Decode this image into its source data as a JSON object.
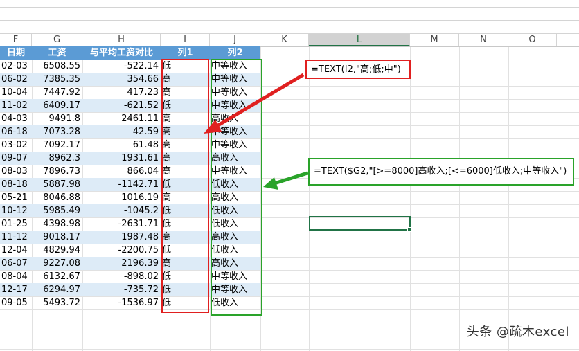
{
  "columns": [
    {
      "letter": "F",
      "selected": false
    },
    {
      "letter": "G",
      "selected": false
    },
    {
      "letter": "H",
      "selected": false
    },
    {
      "letter": "I",
      "selected": false
    },
    {
      "letter": "J",
      "selected": false
    },
    {
      "letter": "K",
      "selected": false
    },
    {
      "letter": "L",
      "selected": true
    },
    {
      "letter": "M",
      "selected": false
    },
    {
      "letter": "N",
      "selected": false
    },
    {
      "letter": "O",
      "selected": false
    }
  ],
  "table": {
    "headers": [
      "日期",
      "工资",
      "与平均工资对比",
      "列1",
      "列2"
    ],
    "rows": [
      [
        "02-03",
        "6508.55",
        "-522.14",
        "低",
        "中等收入"
      ],
      [
        "06-02",
        "7385.35",
        "354.66",
        "高",
        "中等收入"
      ],
      [
        "10-04",
        "7447.92",
        "417.23",
        "高",
        "中等收入"
      ],
      [
        "11-02",
        "6409.17",
        "-621.52",
        "低",
        "中等收入"
      ],
      [
        "04-03",
        "9491.8",
        "2461.11",
        "高",
        "高收入"
      ],
      [
        "06-18",
        "7073.28",
        "42.59",
        "高",
        "中等收入"
      ],
      [
        "03-02",
        "7092.17",
        "61.48",
        "高",
        "中等收入"
      ],
      [
        "09-07",
        "8962.3",
        "1931.61",
        "高",
        "高收入"
      ],
      [
        "08-03",
        "7896.73",
        "866.04",
        "高",
        "中等收入"
      ],
      [
        "08-18",
        "5887.98",
        "-1142.71",
        "低",
        "低收入"
      ],
      [
        "05-21",
        "8046.88",
        "1016.19",
        "高",
        "高收入"
      ],
      [
        "10-12",
        "5985.49",
        "-1045.2",
        "低",
        "低收入"
      ],
      [
        "01-25",
        "4398.98",
        "-2631.71",
        "低",
        "低收入"
      ],
      [
        "11-12",
        "9018.17",
        "1987.48",
        "高",
        "高收入"
      ],
      [
        "12-04",
        "4829.94",
        "-2200.75",
        "低",
        "低收入"
      ],
      [
        "06-07",
        "9227.08",
        "2196.39",
        "高",
        "高收入"
      ],
      [
        "08-04",
        "6132.67",
        "-898.02",
        "低",
        "中等收入"
      ],
      [
        "12-17",
        "6294.97",
        "-735.72",
        "低",
        "中等收入"
      ],
      [
        "09-05",
        "5493.72",
        "-1536.97",
        "低",
        "低收入"
      ]
    ]
  },
  "annotations": {
    "formula1": "=TEXT(I2,\"高;低;中\")",
    "formula2": "=TEXT($G2,\"[>=8000]高收入;[<=6000]低收入;中等收入\")",
    "red_color": "#e02020",
    "green_color": "#2aa32a"
  },
  "watermark": "头条 @疏木excel"
}
